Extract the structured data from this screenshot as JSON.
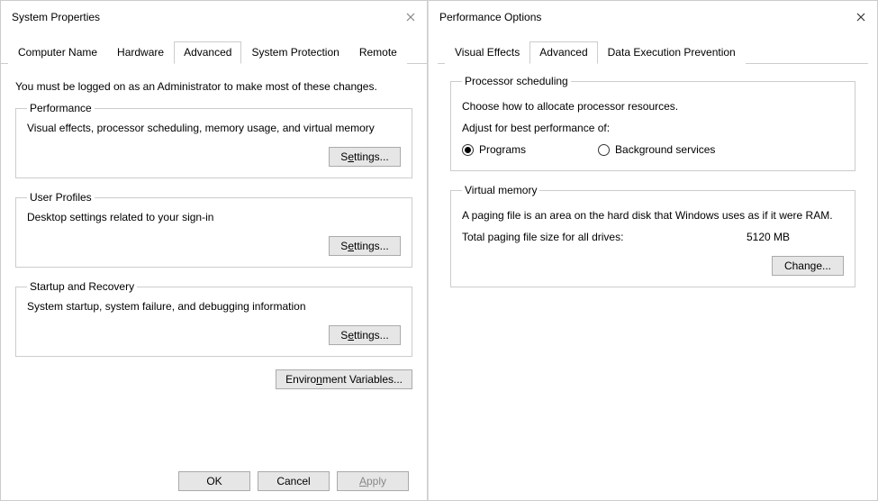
{
  "left": {
    "title": "System Properties",
    "tabs": [
      "Computer Name",
      "Hardware",
      "Advanced",
      "System Protection",
      "Remote"
    ],
    "active_tab": "Advanced",
    "instruct": "You must be logged on as an Administrator to make most of these changes.",
    "groups": {
      "performance": {
        "legend": "Performance",
        "desc": "Visual effects, processor scheduling, memory usage, and virtual memory",
        "button": "Settings..."
      },
      "user_profiles": {
        "legend": "User Profiles",
        "desc": "Desktop settings related to your sign-in",
        "button": "Settings..."
      },
      "startup": {
        "legend": "Startup and Recovery",
        "desc": "System startup, system failure, and debugging information",
        "button": "Settings..."
      }
    },
    "env_button": "Environment Variables...",
    "buttons": {
      "ok": "OK",
      "cancel": "Cancel",
      "apply": "Apply"
    }
  },
  "right": {
    "title": "Performance Options",
    "tabs": [
      "Visual Effects",
      "Advanced",
      "Data Execution Prevention"
    ],
    "active_tab": "Advanced",
    "processor": {
      "legend": "Processor scheduling",
      "desc": "Choose how to allocate processor resources.",
      "adjust": "Adjust for best performance of:",
      "option_programs": "Programs",
      "option_bg": "Background services",
      "selected": "programs"
    },
    "vm": {
      "legend": "Virtual memory",
      "desc": "A paging file is an area on the hard disk that Windows uses as if it were RAM.",
      "total_label": "Total paging file size for all drives:",
      "total_value": "5120 MB",
      "button": "Change..."
    }
  }
}
